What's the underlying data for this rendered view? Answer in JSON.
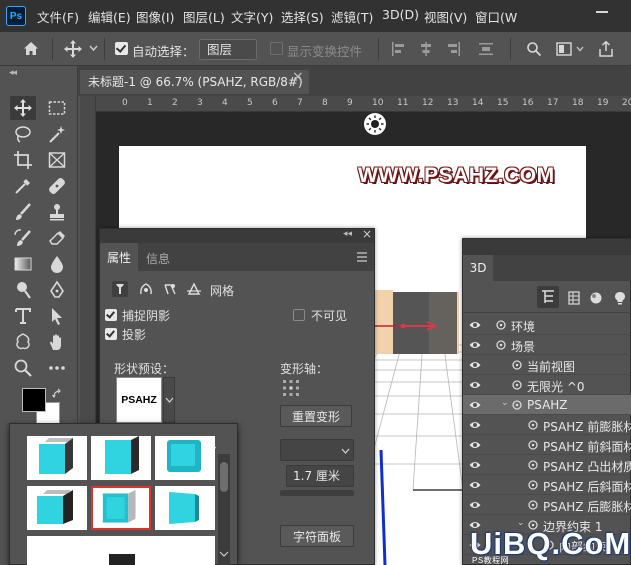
{
  "app": {
    "logo": "Ps"
  },
  "menu": [
    "文件(F)",
    "编辑(E)",
    "图像(I)",
    "图层(L)",
    "文字(Y)",
    "选择(S)",
    "滤镜(T)",
    "3D(D)",
    "视图(V)",
    "窗口(W"
  ],
  "options_bar": {
    "auto_select_label": "自动选择：",
    "auto_select_checked": true,
    "layer_select_value": "图层",
    "show_transform_label": "显示变换控件",
    "show_transform_checked": false
  },
  "document_tab": {
    "title": "未标题-1 @ 66.7% (PSAHZ, RGB/8#) *",
    "close": "×"
  },
  "ruler": {
    "marks": [
      "0",
      "1",
      "2",
      "3",
      "4",
      "5",
      "6",
      "7",
      "8",
      "9",
      "10",
      "11",
      "12",
      "13",
      "14",
      "15",
      "16",
      "17",
      "18",
      "19",
      "20",
      "2"
    ]
  },
  "canvas": {
    "watermark_text": "WWW.PSAHZ.COM"
  },
  "properties_panel": {
    "tabs": [
      "属性",
      "信息"
    ],
    "active_tab": "属性",
    "mode_label": "网格",
    "capture_shadow_label": "捕捉阴影",
    "capture_shadow_checked": true,
    "cast_shadow_label": "投影",
    "cast_shadow_checked": true,
    "invisible_label": "不可见",
    "invisible_checked": false,
    "shape_preset_label": "形状预设：",
    "shape_thumb_text": "PSAHZ",
    "deform_axis_label": "变形轴：",
    "reset_deform_label": "重置变形",
    "depth_value": "1.7 厘米",
    "char_panel_label": "字符面板"
  },
  "panel_3d": {
    "title": "3D",
    "rows": [
      {
        "label": "环境",
        "indent": 0
      },
      {
        "label": "场景",
        "indent": 0
      },
      {
        "label": "当前视图",
        "indent": 1
      },
      {
        "label": "无限光 ^0",
        "indent": 1
      },
      {
        "label": "PSAHZ",
        "indent": 1,
        "selected": true
      },
      {
        "label": "PSAHZ 前膨胀材质",
        "indent": 2
      },
      {
        "label": "PSAHZ 前斜面材质",
        "indent": 2
      },
      {
        "label": "PSAHZ 凸出材质",
        "indent": 2
      },
      {
        "label": "PSAHZ 后斜面材质",
        "indent": 2
      },
      {
        "label": "PSAHZ 后膨胀材质",
        "indent": 2
      },
      {
        "label": "边界约束 1",
        "indent": 2
      },
      {
        "label": "内部约束",
        "indent": 3
      }
    ]
  },
  "colors": {
    "accent_cyan": "#2fd4e0",
    "selection_red": "#e0332b",
    "panel_bg": "#535353",
    "menu_bg": "#323232"
  },
  "site_watermark": {
    "text": "UiBQ.CoM",
    "sub": "PS教程网"
  }
}
